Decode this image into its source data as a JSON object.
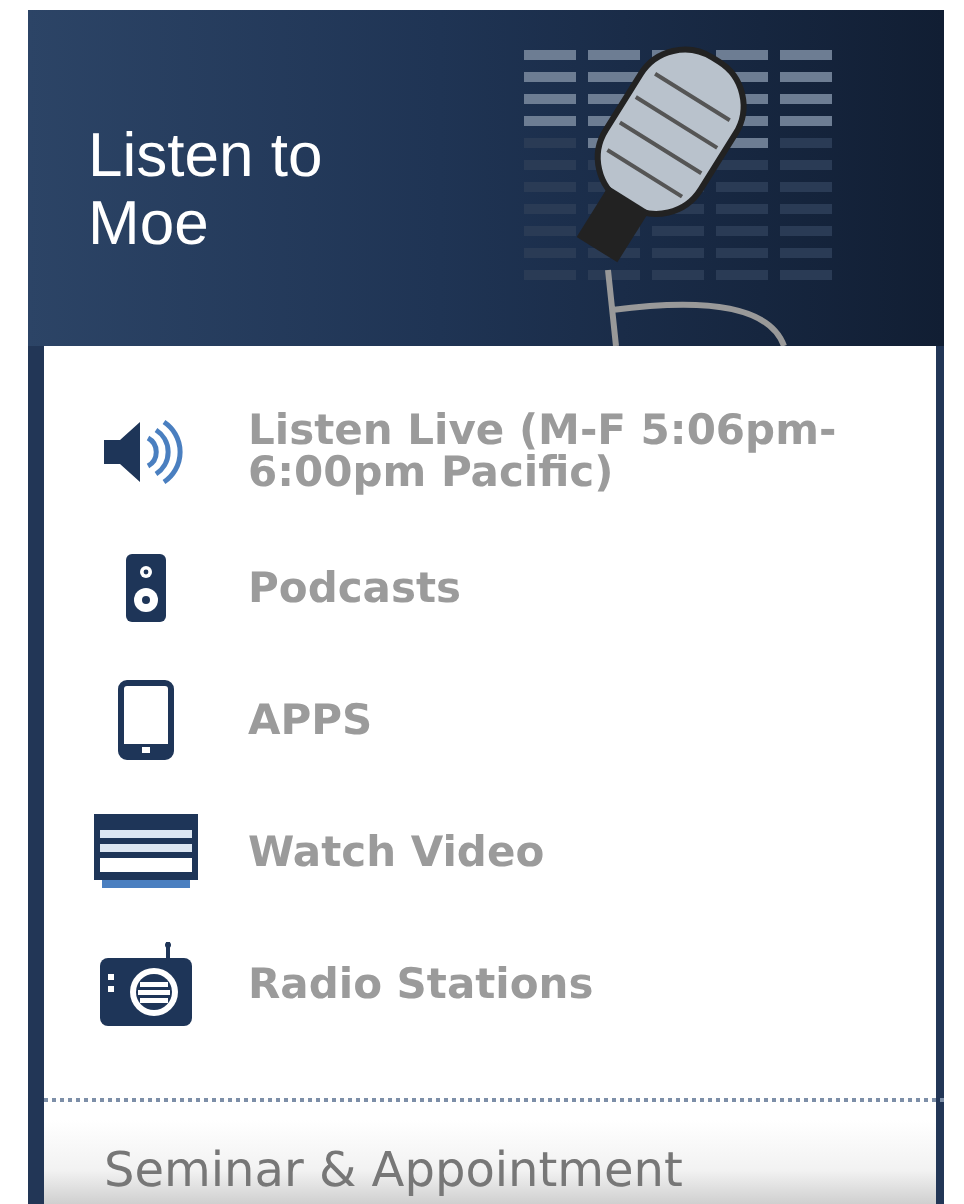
{
  "header": {
    "title": "Listen to Moe"
  },
  "menu": [
    {
      "kind": "speaker",
      "label": "Listen Live (M-F 5:06pm-6:00pm Pacific)"
    },
    {
      "kind": "podcast",
      "label": "Podcasts"
    },
    {
      "kind": "tablet",
      "label": "APPS"
    },
    {
      "kind": "video",
      "label": "Watch Video"
    },
    {
      "kind": "radio",
      "label": "Radio Stations"
    }
  ],
  "next_section": {
    "title": "Seminar & Appointment"
  }
}
